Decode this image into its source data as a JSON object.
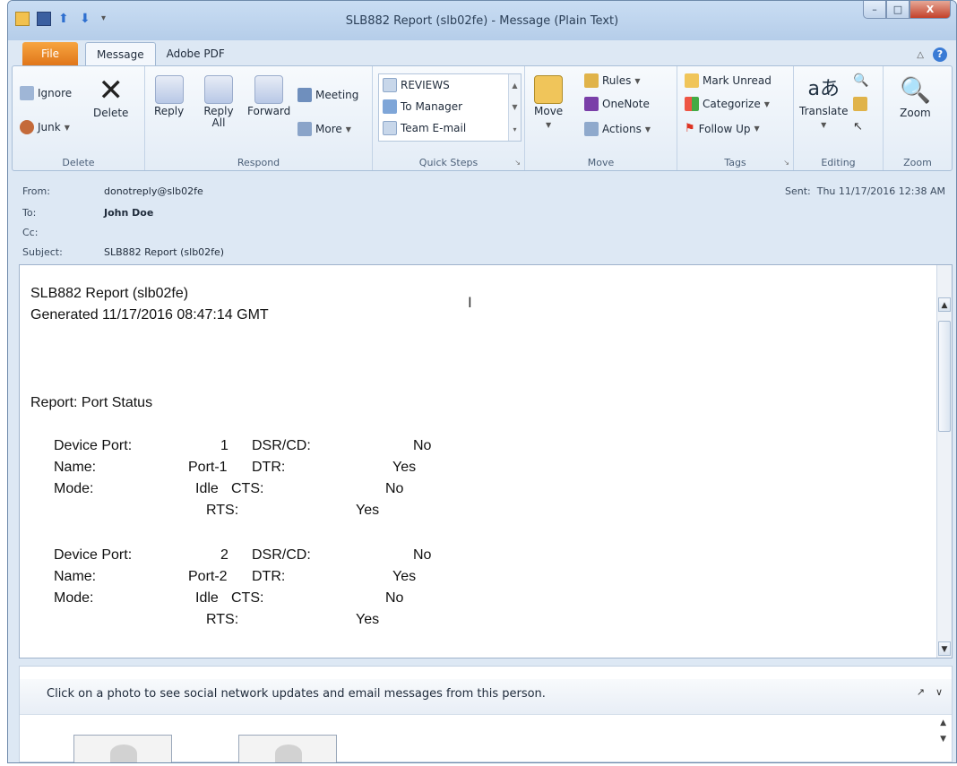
{
  "window": {
    "title": "SLB882 Report (slb02fe)  -  Message (Plain Text)"
  },
  "tabs": [
    "File",
    "Message",
    "Adobe PDF"
  ],
  "ribbon": {
    "delete": {
      "ignore": "Ignore",
      "junk": "Junk",
      "delete": "Delete",
      "label": "Delete"
    },
    "respond": {
      "reply": "Reply",
      "reply_all": "Reply All",
      "forward": "Forward",
      "meeting": "Meeting",
      "more": "More",
      "label": "Respond"
    },
    "quick_steps": {
      "items": [
        "REVIEWS",
        "To Manager",
        "Team E-mail"
      ],
      "label": "Quick Steps"
    },
    "move": {
      "move": "Move",
      "rules": "Rules",
      "onenote": "OneNote",
      "actions": "Actions",
      "label": "Move"
    },
    "tags": {
      "mark_unread": "Mark Unread",
      "categorize": "Categorize",
      "follow_up": "Follow Up",
      "label": "Tags"
    },
    "editing": {
      "translate": "Translate",
      "label": "Editing"
    },
    "zoom": {
      "zoom": "Zoom",
      "label": "Zoom"
    }
  },
  "header": {
    "from_label": "From:",
    "from": "donotreply@slb02fe",
    "to_label": "To:",
    "to": "John Doe",
    "cc_label": "Cc:",
    "cc": "",
    "subject_label": "Subject:",
    "subject": "SLB882 Report (slb02fe)",
    "sent_label": "Sent:",
    "sent": "Thu 11/17/2016 12:38 AM"
  },
  "body": {
    "title": "SLB882 Report (slb02fe)",
    "generated": "Generated 11/17/2016 08:47:14 GMT",
    "report": "Report: Port Status",
    "ports": [
      {
        "device_port_label": "Device Port:",
        "device_port": "1",
        "name_label": "Name:",
        "name": "Port-1",
        "mode_label": "Mode:",
        "mode": "Idle",
        "dsr_label": "DSR/CD:",
        "dsr": "No",
        "dtr_label": "DTR:",
        "dtr": "Yes",
        "cts_label": "CTS:",
        "cts": "No",
        "rts_label": "RTS:",
        "rts": "Yes"
      },
      {
        "device_port_label": "Device Port:",
        "device_port": "2",
        "name_label": "Name:",
        "name": "Port-2",
        "mode_label": "Mode:",
        "mode": "Idle",
        "dsr_label": "DSR/CD:",
        "dsr": "No",
        "dtr_label": "DTR:",
        "dtr": "Yes",
        "cts_label": "CTS:",
        "cts": "No",
        "rts_label": "RTS:",
        "rts": "Yes"
      }
    ]
  },
  "people_pane": {
    "message": "Click on a photo to see social network updates and email messages from this person."
  }
}
